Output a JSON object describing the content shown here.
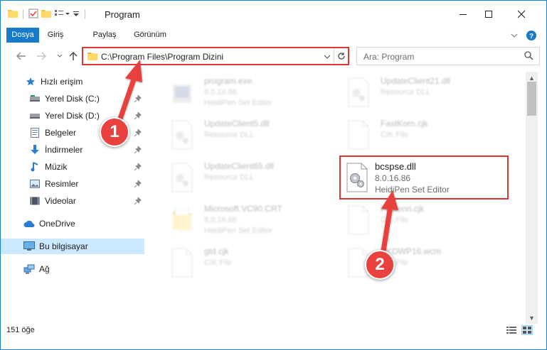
{
  "window": {
    "title": "Program",
    "controls": {
      "minimize": "—",
      "maximize": "☐",
      "close": "✕"
    }
  },
  "ribbon": {
    "tabs": [
      "Dosya",
      "Giriş",
      "Paylaş",
      "Görünüm"
    ]
  },
  "nav": {
    "address": "C:\\Program Files\\Program Dizini",
    "search_placeholder": "Ara: Program"
  },
  "sidebar": {
    "items": [
      {
        "label": "Hızlı erişim",
        "icon": "star-icon"
      },
      {
        "label": "Yerel Disk (C:)",
        "icon": "drive-icon",
        "pinned": true
      },
      {
        "label": "Yerel Disk (D:)",
        "icon": "drive-icon",
        "pinned": true
      },
      {
        "label": "Belgeler",
        "icon": "documents-icon",
        "pinned": true
      },
      {
        "label": "İndirmeler",
        "icon": "download-icon",
        "pinned": true
      },
      {
        "label": "Müzik",
        "icon": "music-icon",
        "pinned": true
      },
      {
        "label": "Resimler",
        "icon": "pictures-icon",
        "pinned": true
      },
      {
        "label": "Videolar",
        "icon": "video-icon",
        "pinned": true
      },
      {
        "label": "OneDrive",
        "icon": "cloud-icon"
      },
      {
        "label": "Bu bilgisayar",
        "icon": "computer-icon",
        "selected": true
      },
      {
        "label": "Ağ",
        "icon": "network-icon"
      }
    ]
  },
  "files": [
    {
      "name": "program.exe",
      "line2": "8.0.16.86",
      "line3": "HeidiPen Set Editor",
      "icon": "exe-icon"
    },
    {
      "name": "UpdateClient21.dll",
      "line2": "Resource DLL",
      "line3": "",
      "icon": "dll-icon"
    },
    {
      "name": "UpdateClient5.dll",
      "line2": "Resource DLL",
      "line3": "",
      "icon": "dll-icon"
    },
    {
      "name": "FastKorn.cjk",
      "line2": "CIK File",
      "line3": "",
      "icon": "file-icon"
    },
    {
      "name": "UpdateClient65.dll",
      "line2": "Resource DLL",
      "line3": "",
      "icon": "dll-icon"
    },
    {
      "name": "bcspse.dll",
      "line2": "8.0.16.86",
      "line3": "HeidiPen Set Editor",
      "icon": "dll-icon",
      "highlighted": true
    },
    {
      "name": "Microsoft.VC90.CRT",
      "line2": "8.0.16.86",
      "line3": "HeidiPen Set Editor",
      "icon": "folder-icon"
    },
    {
      "name": "Fastenri.cjk",
      "line2": "CIK File",
      "line3": "",
      "icon": "file-icon"
    },
    {
      "name": "gtd.cjk",
      "line2": "CIK File",
      "line3": "",
      "icon": "file-icon"
    },
    {
      "name": "SKDWP16.wcm",
      "line2": "CIK File",
      "line3": "",
      "icon": "file-icon"
    }
  ],
  "status": {
    "count": "151 öğe"
  },
  "annotations": {
    "step1": "1",
    "step2": "2"
  },
  "colors": {
    "accent": "#1979ca",
    "highlight": "#e03535",
    "selected": "#cce8ff"
  }
}
